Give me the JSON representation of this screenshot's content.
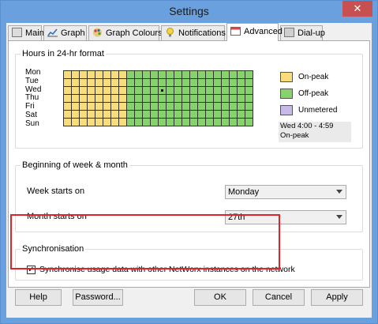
{
  "window": {
    "title": "Settings",
    "close_glyph": "✕"
  },
  "tabs": [
    {
      "label": "Main",
      "icon": "main-icon",
      "active": false
    },
    {
      "label": "Graph",
      "icon": "graph-icon",
      "active": false
    },
    {
      "label": "Graph Colours",
      "icon": "palette-icon",
      "active": false
    },
    {
      "label": "Notifications",
      "icon": "lightbulb-icon",
      "active": false
    },
    {
      "label": "Advanced",
      "icon": "calendar-icon",
      "active": true
    },
    {
      "label": "Dial-up",
      "icon": "dialup-icon",
      "active": false
    }
  ],
  "hours": {
    "group_label": "Hours in 24-hr format",
    "days": [
      "Mon",
      "Tue",
      "Wed",
      "Thu",
      "Fri",
      "Sat",
      "Sun"
    ],
    "on_peak_hours_per_day": 8,
    "selected_cell": {
      "day": "Wed",
      "hour": 4
    },
    "legend": [
      {
        "label": "On-peak",
        "color": "#f9dd7a"
      },
      {
        "label": "Off-peak",
        "color": "#86d36b"
      },
      {
        "label": "Unmetered",
        "color": "#c9b9e8"
      }
    ],
    "info_line1": "Wed 4:00 - 4:59",
    "info_line2": "On-peak"
  },
  "week": {
    "group_label": "Beginning of week & month",
    "week_label": "Week starts on",
    "week_value": "Monday",
    "month_label": "Month starts on",
    "month_value": "27th"
  },
  "sync": {
    "group_label": "Synchronisation",
    "checkbox_label": "Synchronise usage data with other NetWorx instances on the network",
    "checked": true
  },
  "buttons": {
    "help": "Help",
    "password": "Password...",
    "ok": "OK",
    "cancel": "Cancel",
    "apply": "Apply"
  },
  "colors": {
    "highlight_border": "#e0222b",
    "grid_line": "#333333"
  }
}
